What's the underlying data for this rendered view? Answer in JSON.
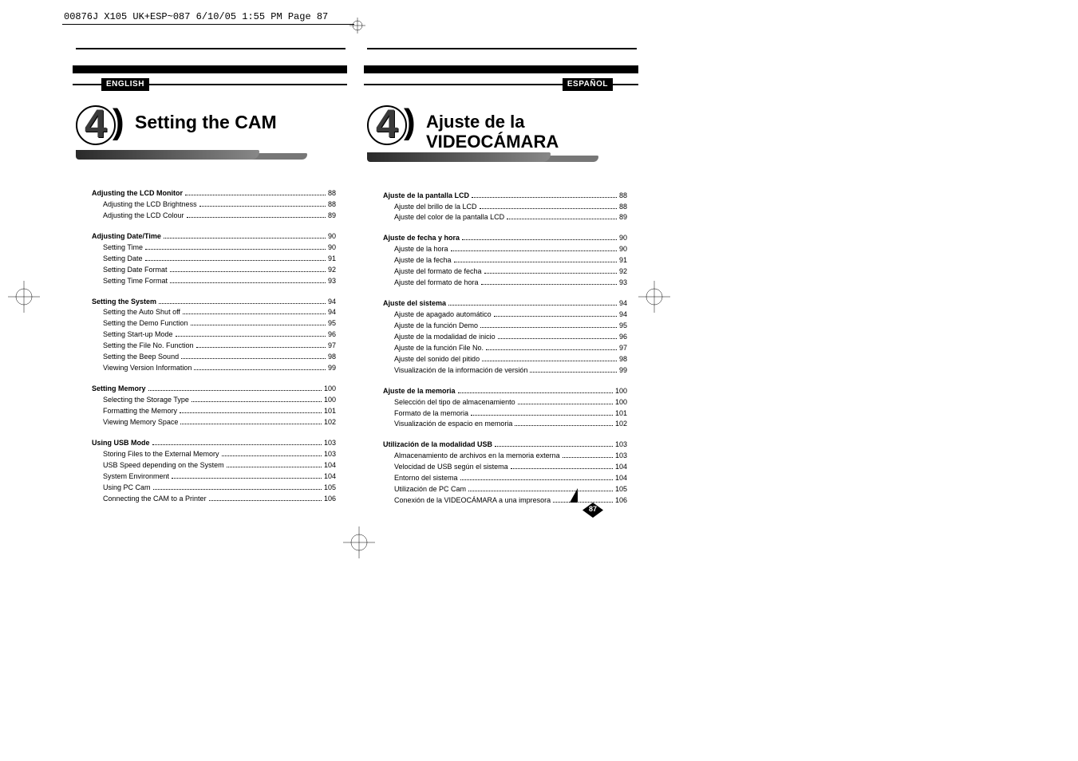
{
  "slug": "00876J X105 UK+ESP~087  6/10/05 1:55 PM  Page 87",
  "page_number": "87",
  "chapter_number": "4",
  "left": {
    "lang": "ENGLISH",
    "title": "Setting the CAM",
    "sections": [
      {
        "heading": {
          "label": "Adjusting the LCD Monitor",
          "page": "88"
        },
        "items": [
          {
            "label": "Adjusting the LCD Brightness",
            "page": "88"
          },
          {
            "label": "Adjusting the LCD Colour",
            "page": "89"
          }
        ]
      },
      {
        "heading": {
          "label": "Adjusting Date/Time",
          "page": "90"
        },
        "items": [
          {
            "label": "Setting Time",
            "page": "90"
          },
          {
            "label": "Setting Date",
            "page": "91"
          },
          {
            "label": "Setting Date Format",
            "page": "92"
          },
          {
            "label": "Setting Time Format",
            "page": "93"
          }
        ]
      },
      {
        "heading": {
          "label": "Setting the System",
          "page": "94"
        },
        "items": [
          {
            "label": "Setting the Auto Shut off",
            "page": "94"
          },
          {
            "label": "Setting the Demo Function",
            "page": "95"
          },
          {
            "label": "Setting Start-up Mode",
            "page": "96"
          },
          {
            "label": "Setting the File No. Function",
            "page": "97"
          },
          {
            "label": "Setting the Beep Sound",
            "page": "98"
          },
          {
            "label": "Viewing Version Information",
            "page": "99"
          }
        ]
      },
      {
        "heading": {
          "label": "Setting Memory",
          "page": "100"
        },
        "items": [
          {
            "label": "Selecting the Storage Type",
            "page": "100"
          },
          {
            "label": "Formatting the Memory",
            "page": "101"
          },
          {
            "label": "Viewing Memory Space",
            "page": "102"
          }
        ]
      },
      {
        "heading": {
          "label": "Using USB Mode",
          "page": "103"
        },
        "items": [
          {
            "label": "Storing Files to the External Memory",
            "page": "103"
          },
          {
            "label": "USB Speed depending on the System",
            "page": "104"
          },
          {
            "label": "System Environment",
            "page": "104"
          },
          {
            "label": "Using PC Cam",
            "page": "105"
          },
          {
            "label": "Connecting the CAM to a Printer",
            "page": "106"
          }
        ]
      }
    ]
  },
  "right": {
    "lang": "ESPAÑOL",
    "title": "Ajuste de la VIDEOCÁMARA",
    "sections": [
      {
        "heading": {
          "label": "Ajuste de la pantalla LCD",
          "page": "88"
        },
        "items": [
          {
            "label": "Ajuste del brillo de la LCD",
            "page": "88"
          },
          {
            "label": "Ajuste del color de la pantalla LCD",
            "page": "89"
          }
        ]
      },
      {
        "heading": {
          "label": "Ajuste de fecha y hora",
          "page": "90"
        },
        "items": [
          {
            "label": "Ajuste de la hora",
            "page": "90"
          },
          {
            "label": "Ajuste de la fecha",
            "page": "91"
          },
          {
            "label": "Ajuste del formato de fecha",
            "page": "92"
          },
          {
            "label": "Ajuste del formato de hora",
            "page": "93"
          }
        ]
      },
      {
        "heading": {
          "label": "Ajuste del sistema",
          "page": "94"
        },
        "items": [
          {
            "label": "Ajuste de apagado automático",
            "page": "94"
          },
          {
            "label": "Ajuste de la función Demo",
            "page": "95"
          },
          {
            "label": "Ajuste de la modalidad de inicio",
            "page": "96"
          },
          {
            "label": "Ajuste de la función File No.",
            "page": "97"
          },
          {
            "label": "Ajuste del sonido del pitido",
            "page": "98"
          },
          {
            "label": "Visualización de la información de versión",
            "page": "99"
          }
        ]
      },
      {
        "heading": {
          "label": "Ajuste de la memoria",
          "page": "100"
        },
        "items": [
          {
            "label": "Selección del tipo de almacenamiento",
            "page": "100"
          },
          {
            "label": "Formato de la memoria",
            "page": "101"
          },
          {
            "label": "Visualización de espacio en memoria",
            "page": "102"
          }
        ]
      },
      {
        "heading": {
          "label": "Utilización de la modalidad USB",
          "page": "103"
        },
        "items": [
          {
            "label": "Almacenamiento de archivos en la memoria externa",
            "page": "103"
          },
          {
            "label": "Velocidad de USB según el sistema",
            "page": "104"
          },
          {
            "label": "Entorno del sistema",
            "page": "104"
          },
          {
            "label": "Utilización de PC Cam",
            "page": "105"
          },
          {
            "label": "Conexión de la VIDEOCÁMARA a una impresora",
            "page": "106"
          }
        ]
      }
    ]
  }
}
